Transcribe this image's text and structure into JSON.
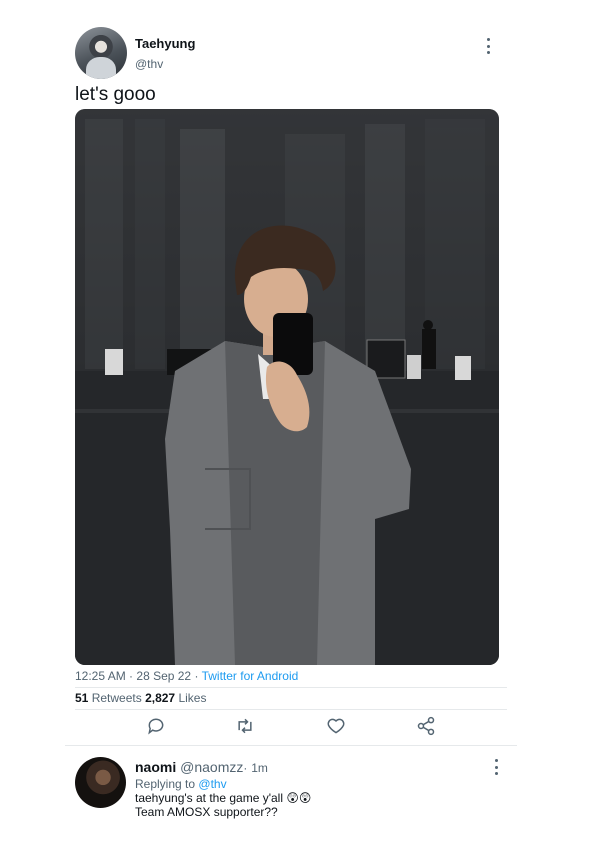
{
  "tweet": {
    "author_name": "Taehyung",
    "author_handle": "@thv",
    "text": "let's gooo",
    "time": "12:25 AM",
    "date": "28 Sep 22",
    "source": "Twitter for Android",
    "separator": "·",
    "retweets_count": "51",
    "retweets_label": "Retweets",
    "likes_count": "2,827",
    "likes_label": "Likes",
    "photo": "selfie-on-stage-photo"
  },
  "actions": [
    "reply-icon",
    "retweet-icon",
    "like-icon",
    "share-icon"
  ],
  "reply": {
    "author_name": "naomi",
    "author_handle": "@naomzz",
    "separator": "·",
    "time_ago": "1m",
    "replying_label": "Replying to",
    "replying_to": "@thv",
    "line1": "taehyung's at the game y'all 😲😲",
    "line2": "Team AMOSX supporter??"
  },
  "colors": {
    "link": "#1d9bf0",
    "secondary_text": "#536471",
    "primary_text": "#0f1419"
  }
}
